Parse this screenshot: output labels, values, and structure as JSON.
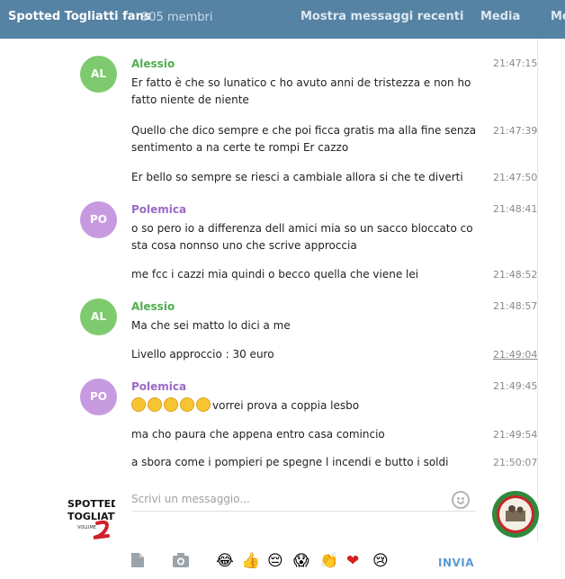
{
  "header": {
    "title": "Spotted Togliatti fans",
    "members": "905 membri",
    "recent": "Mostra messaggi recenti",
    "media": "Media",
    "more": "Mo"
  },
  "colors": {
    "header": "#5682a3",
    "alessio": "#4fae4e",
    "polemica": "#9a69c4",
    "send": "#5b9bd1"
  },
  "messages": [
    {
      "avatar": "AL",
      "author": "Alessio",
      "text": "Er fatto è che so lunatico c ho avuto anni de tristezza e non ho fatto niente de niente",
      "time": "21:47:15"
    },
    {
      "text": "Quello che dico sempre e che poi ficca gratis ma alla fine senza sentimento a na certe te rompi Er cazzo",
      "time": "21:47:39"
    },
    {
      "text": "Er bello so sempre se riesci a cambiale allora si che te diverti",
      "time": "21:47:50"
    },
    {
      "avatar": "PO",
      "author": "Polemica",
      "text": "o so pero io a differenza dell amici mia so un sacco bloccato co sta cosa nonnso uno che scrive approccia",
      "time": "21:48:41"
    },
    {
      "text": "me fcc i cazzi mia quindi o becco quella che viene lei",
      "time": "21:48:52"
    },
    {
      "avatar": "AL",
      "author": "Alessio",
      "text": "Ma che sei matto lo dici a me",
      "time": "21:48:57"
    },
    {
      "text": "Livello approccio : 30 euro",
      "time": "21:49:04"
    },
    {
      "avatar": "PO",
      "author": "Polemica",
      "text": "vorrei prova a coppia lesbo",
      "time": "21:49:45"
    },
    {
      "text": "ma cho paura che appena entro casa comincio",
      "time": "21:49:54"
    },
    {
      "text": "a sbora come i pompieri pe spegne l incendi e butto i soldi",
      "time": "21:50:07"
    }
  ],
  "composer": {
    "placeholder": "Scrivi un messaggio...",
    "send": "INVIA",
    "logo_text": "SPOTTED TOGLIATTI",
    "logo_sub": "VOLUME",
    "quick_emoji": [
      "😂",
      "👍",
      "😔",
      "😱",
      "👏",
      "❤",
      "😢"
    ],
    "icons": [
      "file-icon",
      "camera-icon"
    ]
  }
}
